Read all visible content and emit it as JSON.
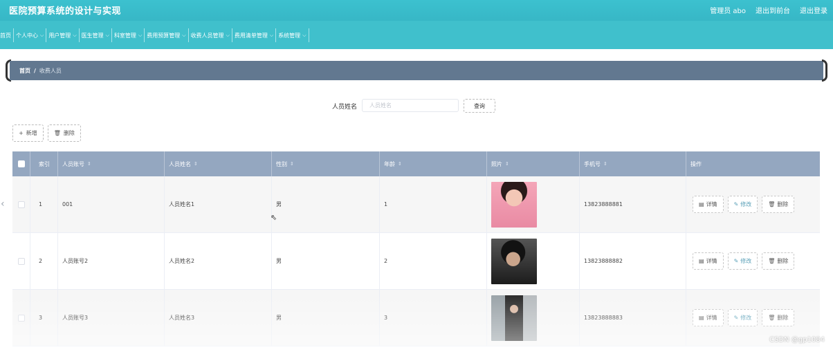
{
  "app": {
    "title": "医院预算系统的设计与实现",
    "admin_label": "管理员 abo",
    "exit_front_label": "退出到前台",
    "logout_label": "退出登录"
  },
  "nav": {
    "items": [
      {
        "label": "首页",
        "has_dropdown": false
      },
      {
        "label": "个人中心",
        "has_dropdown": true
      },
      {
        "label": "用户管理",
        "has_dropdown": true
      },
      {
        "label": "医生管理",
        "has_dropdown": true
      },
      {
        "label": "科室管理",
        "has_dropdown": true
      },
      {
        "label": "费用预算管理",
        "has_dropdown": true
      },
      {
        "label": "收费人员管理",
        "has_dropdown": true
      },
      {
        "label": "费用清单管理",
        "has_dropdown": true
      },
      {
        "label": "系统管理",
        "has_dropdown": true
      }
    ]
  },
  "breadcrumb": {
    "home": "首页",
    "separator": "/",
    "current": "收费人员"
  },
  "search": {
    "label": "人员姓名",
    "placeholder": "人员姓名",
    "button_label": "查询"
  },
  "actions": {
    "add_label": "新增",
    "delete_label": "删除"
  },
  "table": {
    "headers": {
      "index": "索引",
      "account": "人员账号",
      "name": "人员姓名",
      "sex": "性别",
      "age": "年龄",
      "photo": "照片",
      "phone": "手机号",
      "ops": "操作"
    },
    "sort_glyph": "⇕",
    "rows": [
      {
        "index": "1",
        "account": "001",
        "name": "人员姓名1",
        "sex": "男",
        "age": "1",
        "phone": "13823888881"
      },
      {
        "index": "2",
        "account": "人员账号2",
        "name": "人员姓名2",
        "sex": "男",
        "age": "2",
        "phone": "13823888882"
      },
      {
        "index": "3",
        "account": "人员账号3",
        "name": "人员姓名3",
        "sex": "男",
        "age": "3",
        "phone": "13823888883"
      }
    ],
    "row_actions": {
      "detail": "详情",
      "edit": "修改",
      "delete": "删除"
    }
  },
  "watermark": "CSDN @gp1084",
  "colors": {
    "topbar": "#3cc1cf",
    "navbar": "#40c0cc",
    "breadcrumb": "#627890",
    "table_header": "#94a7c0",
    "edit_accent": "#5aa0b8"
  }
}
